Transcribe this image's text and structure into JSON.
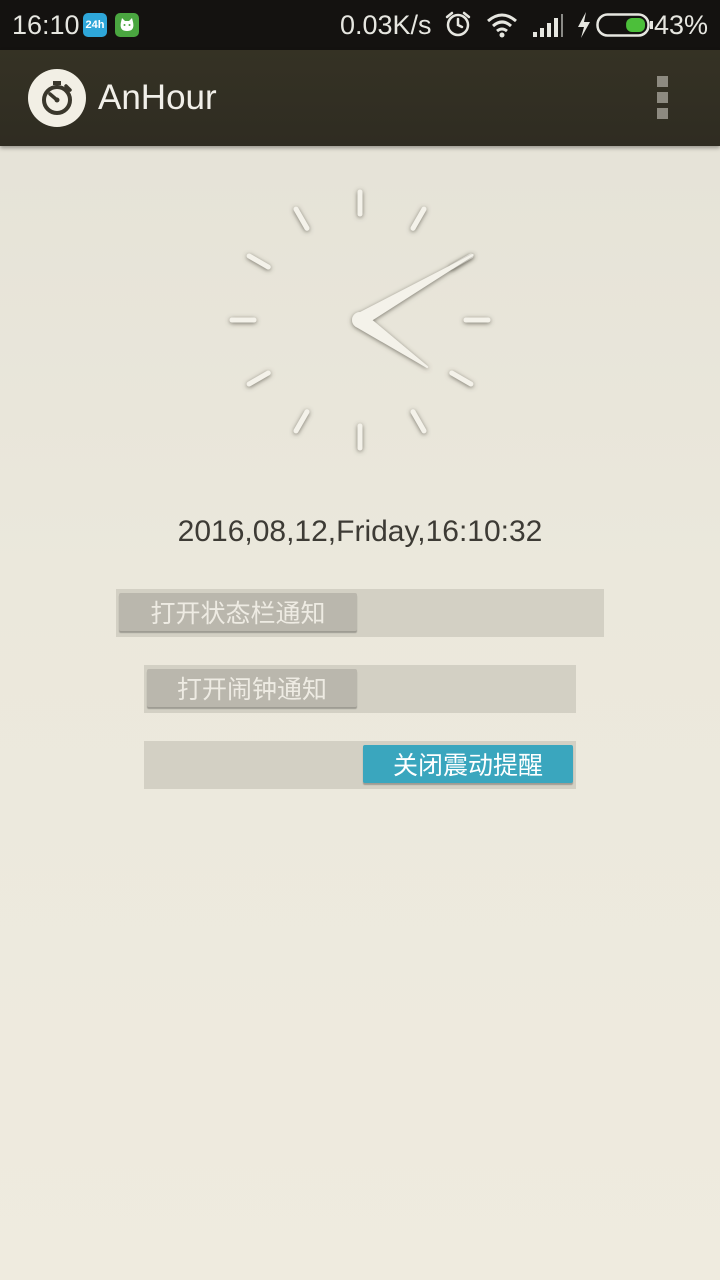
{
  "status_bar": {
    "time": "16:10",
    "notification_icons": [
      "24h-app-icon",
      "android-cat-icon"
    ],
    "notif_24_label": "24h",
    "network_speed": "0.03K/s",
    "battery_percent": "43%",
    "battery_level": 0.43,
    "battery_color": "#4cbf3a"
  },
  "action_bar": {
    "title": "AnHour"
  },
  "clock": {
    "hour": 16,
    "minute": 10,
    "hand_color": "#f4f2ea",
    "marker_color": "#f4f2ea"
  },
  "datetime_text": "2016,08,12,Friday,16:10:32",
  "toggles": [
    {
      "label": "打开状态栏通知",
      "state": "off"
    },
    {
      "label": "打开闹钟通知",
      "state": "off"
    },
    {
      "label": "关闭震动提醒",
      "state": "on"
    }
  ],
  "colors": {
    "accent": "#3aa6be",
    "action_bar": "#33301f",
    "status_bar": "#141210"
  }
}
